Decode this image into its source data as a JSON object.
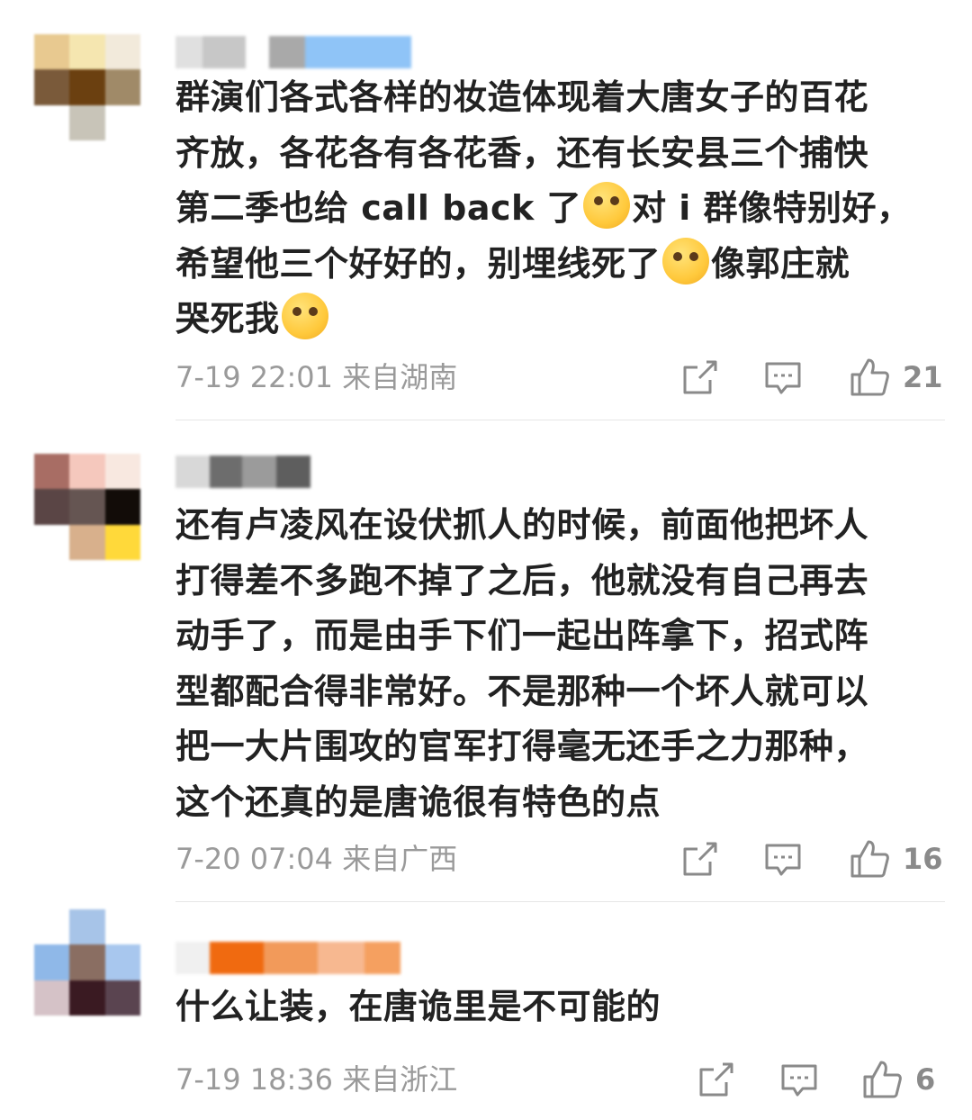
{
  "comments": [
    {
      "avatar_colors": [
        "#e8c990",
        "#f5e6b0",
        "#f2eadb",
        "#7a5a3a",
        "#6b4010",
        "#a08a68",
        "#ffffff",
        "#c8c4b8",
        "#ffffff"
      ],
      "username_colors": [
        "#e0e0e0",
        "#c7c7c7",
        "#ffffff",
        "#a9a9a9",
        "#8fc4f7"
      ],
      "text_parts": [
        "群演们各式各样的妆造体现着大唐女子的百花\n齐放，各花各有各花香，还有长安县三个捕快\n第二季也给 call back 了",
        "对 i 群像特别好，\n希望他三个好好的，别埋线死了",
        "像郭庄就\n哭死我",
        ""
      ],
      "time": "7-19 22:01 来自湖南",
      "likes": "21"
    },
    {
      "avatar_colors": [
        "#a86d64",
        "#f5c8bd",
        "#f8e8e0",
        "#5a4545",
        "#655552",
        "#120c08",
        "#ffffff",
        "#d8b08c",
        "#ffd93a"
      ],
      "username_colors": [
        "#d8d8d8",
        "#6d6d6d",
        "#9b9b9b",
        "#5e5e5e",
        "#ffffff"
      ],
      "text": "还有卢凌风在设伏抓人的时候，前面他把坏人\n打得差不多跑不掉了之后，他就没有自己再去\n动手了，而是由手下们一起出阵拿下，招式阵\n型都配合得非常好。不是那种一个坏人就可以\n把一大片围攻的官军打得毫无还手之力那种，\n这个还真的是唐诡很有特色的点",
      "time": "7-20 07:04 来自广西",
      "likes": "16"
    },
    {
      "avatar_colors": [
        "#ffffff",
        "#a7c4e8",
        "#ffffff",
        "#8fb8e8",
        "#8a6e62",
        "#a8c7ee",
        "#d5c2c7",
        "#3a1a22",
        "#5a4450"
      ],
      "username_colors": [
        "#f0f0f0",
        "#f06a10",
        "#f29a5a",
        "#f7b890",
        "#f5a060"
      ],
      "text": "什么让装，在唐诡里是不可能的",
      "time": "7-19 18:36 来自浙江",
      "likes": "6"
    }
  ],
  "icons": {
    "share": "share-icon",
    "comment": "comment-icon",
    "like": "thumbs-up-icon"
  },
  "colors": {
    "text": "#222222",
    "meta": "#9a9a9a",
    "icon": "#8a8a8a",
    "divider": "#e6e6e6"
  }
}
